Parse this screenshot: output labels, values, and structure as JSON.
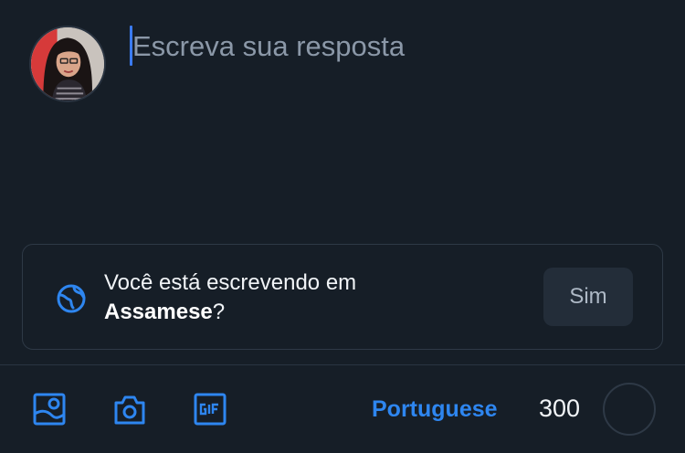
{
  "composer": {
    "placeholder": "Escreva sua resposta"
  },
  "language_suggestion": {
    "message_prefix": "Você está escrevendo em",
    "language": "Assamese",
    "message_suffix": "?",
    "confirm_label": "Sim"
  },
  "toolbar": {
    "icons": [
      "image-icon",
      "camera-icon",
      "gif-icon"
    ],
    "language_label": "Portuguese",
    "char_count": "300"
  },
  "colors": {
    "background": "#161e27",
    "accent": "#2e86f0",
    "caret": "#3b7bf0",
    "placeholder": "#8b98a8",
    "border": "#2e3946"
  }
}
